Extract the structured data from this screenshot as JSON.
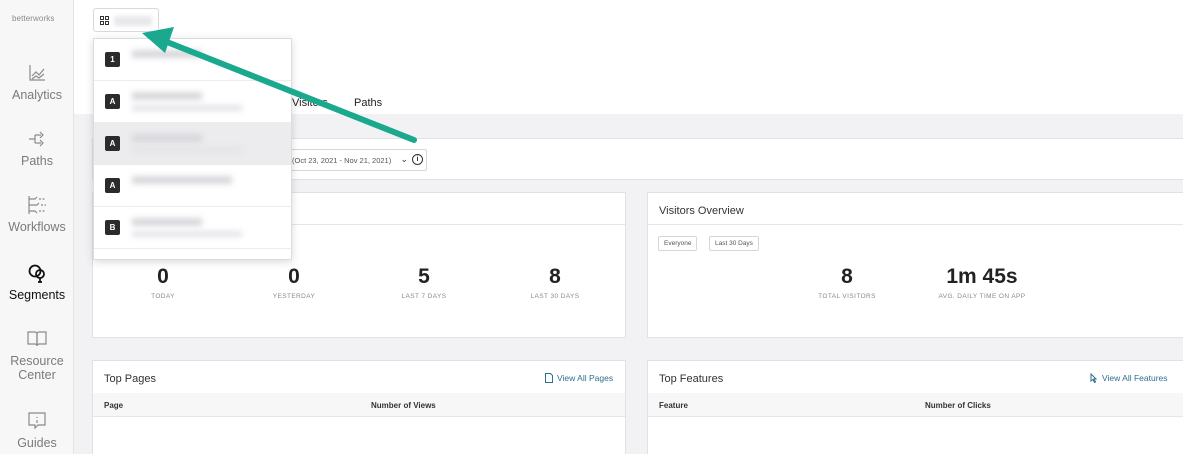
{
  "brand": {
    "logo_text": "betterworks",
    "accent_color": "#1aa88e"
  },
  "sidebar": {
    "items": [
      {
        "label": "Analytics",
        "icon": "line-chart-icon"
      },
      {
        "label": "Paths",
        "icon": "paths-icon"
      },
      {
        "label": "Workflows",
        "icon": "workflows-icon"
      },
      {
        "label": "Segments",
        "icon": "segments-icon",
        "active": true
      },
      {
        "label": "Resource Center",
        "icon": "book-icon"
      },
      {
        "label": "Guides",
        "icon": "guides-icon"
      }
    ]
  },
  "header": {
    "tabs": [
      {
        "label": "Visitors"
      },
      {
        "label": "Paths"
      }
    ]
  },
  "filters": {
    "date_range": "(Oct 23, 2021 - Nov 21, 2021)",
    "info_glyph": "i"
  },
  "dropdown": {
    "items": [
      {
        "badge": "1"
      },
      {
        "badge": "A"
      },
      {
        "badge": "A"
      },
      {
        "badge": "A"
      },
      {
        "badge": "B"
      }
    ]
  },
  "visitors_card": {
    "metrics": [
      {
        "value": "0",
        "label": "TODAY"
      },
      {
        "value": "0",
        "label": "YESTERDAY"
      },
      {
        "value": "5",
        "label": "LAST 7 DAYS"
      },
      {
        "value": "8",
        "label": "LAST 30 DAYS"
      }
    ]
  },
  "visitors_overview": {
    "title": "Visitors Overview",
    "pills": [
      "Everyone",
      "Last 30 Days"
    ],
    "metrics": [
      {
        "value": "8",
        "label": "TOTAL VISITORS"
      },
      {
        "value": "1m 45s",
        "label": "AVG. DAILY TIME ON APP"
      }
    ]
  },
  "top_pages": {
    "title": "Top Pages",
    "view_all": "View All Pages",
    "columns": [
      "Page",
      "Number of Views"
    ]
  },
  "top_features": {
    "title": "Top Features",
    "view_all": "View All Features",
    "columns": [
      "Feature",
      "Number of Clicks"
    ]
  }
}
